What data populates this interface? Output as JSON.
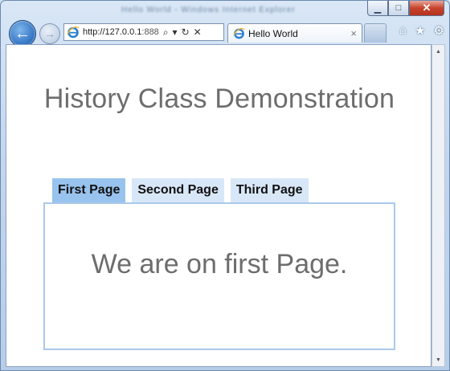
{
  "browser": {
    "window_title_blurred": "Hello World - Windows Internet Explorer",
    "address_url_host": "http://127.0.0.1",
    "address_url_port": ":888",
    "tab_title": "Hello World",
    "tab_close_glyph": "×",
    "buttons": {
      "minimize": "▁",
      "maximize": "□",
      "close": "✕",
      "back": "←",
      "forward": "→",
      "search": "⌕",
      "dropdown": "▾",
      "refresh": "↻",
      "stop": "✕"
    },
    "tools": {
      "home": "⌂",
      "favorites": "★",
      "settings": "⚙"
    },
    "scroll": {
      "up": "▲",
      "down": "▼"
    }
  },
  "page": {
    "heading": "History Class Demonstration",
    "tabs": [
      {
        "label": "First Page",
        "active": true
      },
      {
        "label": "Second Page",
        "active": false
      },
      {
        "label": "Third Page",
        "active": false
      }
    ],
    "panel_text": "We are on first Page."
  },
  "colors": {
    "active_tab": "#98c3ee",
    "inactive_tab": "#d8e7f8",
    "panel_border": "#a9c9ea",
    "text_gray": "#6d6d6d"
  }
}
